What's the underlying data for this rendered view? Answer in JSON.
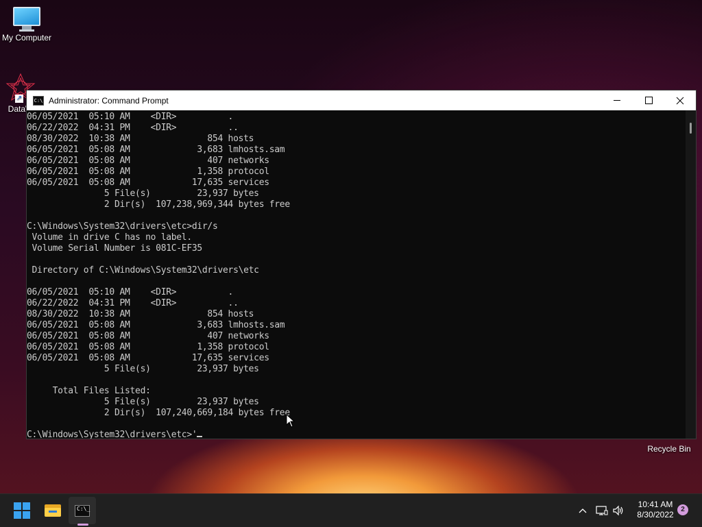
{
  "desktop": {
    "icons": [
      {
        "label": "My Computer",
        "icon": "monitor-icon"
      },
      {
        "label": "DataW",
        "icon": "dataw-app-icon"
      },
      {
        "label": "Recycle Bin",
        "icon": "recycle-bin-icon"
      }
    ]
  },
  "window": {
    "title": "Administrator: Command Prompt",
    "icon": "cmd-icon",
    "controls": {
      "minimize": "minimize-icon",
      "maximize": "maximize-icon",
      "close": "close-icon"
    }
  },
  "console": {
    "lines": [
      "06/05/2021  05:10 AM    <DIR>          .",
      "06/22/2022  04:31 PM    <DIR>          ..",
      "08/30/2022  10:38 AM               854 hosts",
      "06/05/2021  05:08 AM             3,683 lmhosts.sam",
      "06/05/2021  05:08 AM               407 networks",
      "06/05/2021  05:08 AM             1,358 protocol",
      "06/05/2021  05:08 AM            17,635 services",
      "               5 File(s)         23,937 bytes",
      "               2 Dir(s)  107,238,969,344 bytes free",
      "",
      "C:\\Windows\\System32\\drivers\\etc>dir/s",
      " Volume in drive C has no label.",
      " Volume Serial Number is 081C-EF35",
      "",
      " Directory of C:\\Windows\\System32\\drivers\\etc",
      "",
      "06/05/2021  05:10 AM    <DIR>          .",
      "06/22/2022  04:31 PM    <DIR>          ..",
      "08/30/2022  10:38 AM               854 hosts",
      "06/05/2021  05:08 AM             3,683 lmhosts.sam",
      "06/05/2021  05:08 AM               407 networks",
      "06/05/2021  05:08 AM             1,358 protocol",
      "06/05/2021  05:08 AM            17,635 services",
      "               5 File(s)         23,937 bytes",
      "",
      "     Total Files Listed:",
      "               5 File(s)         23,937 bytes",
      "               2 Dir(s)  107,240,669,184 bytes free",
      ""
    ],
    "prompt": "C:\\Windows\\System32\\drivers\\etc>",
    "input": "'"
  },
  "taskbar": {
    "apps": [
      {
        "name": "Start",
        "icon": "windows-start-icon"
      },
      {
        "name": "File Explorer",
        "icon": "folder-icon"
      },
      {
        "name": "Command Prompt",
        "icon": "cmd-icon",
        "active": true
      }
    ],
    "tray": {
      "chevron": "chevron-up-icon",
      "network": "network-icon",
      "volume": "volume-icon"
    },
    "clock": {
      "time": "10:41 AM",
      "date": "8/30/2022"
    },
    "notification_count": "2"
  },
  "colors": {
    "console_bg": "#0c0c0c",
    "console_text": "#cccccc",
    "taskbar_bg": "#202020",
    "accent": "#d39cdd",
    "start_blue": "#3aa3f0"
  }
}
